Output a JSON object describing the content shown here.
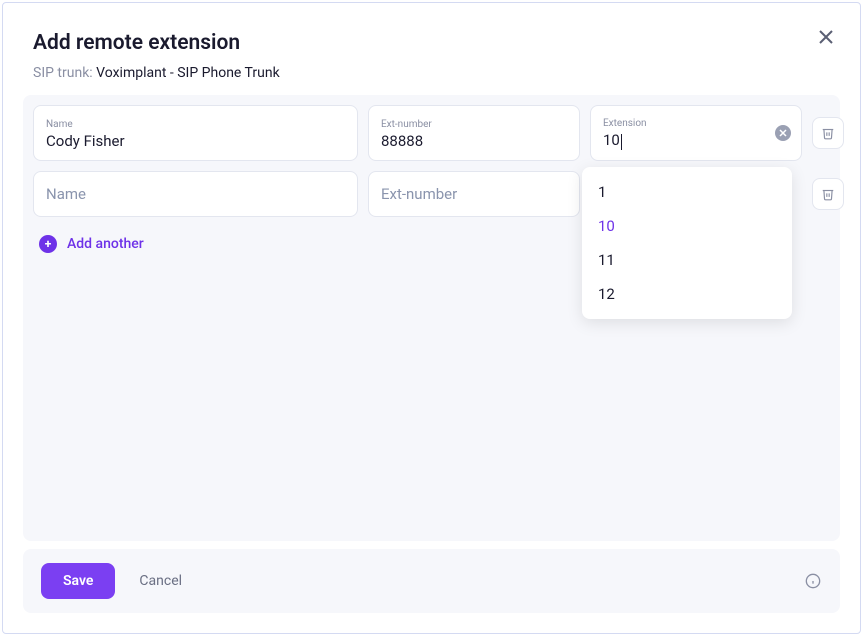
{
  "header": {
    "title": "Add remote extension",
    "subtitle_label": "SIP trunk:",
    "subtitle_value": "Voximplant -  SIP Phone Trunk"
  },
  "rows": [
    {
      "name_label": "Name",
      "name_value": "Cody Fisher",
      "ext_label": "Ext-number",
      "ext_value": "88888",
      "extension_label": "Extension",
      "extension_value": "10"
    },
    {
      "name_placeholder": "Name",
      "ext_placeholder": "Ext-number"
    }
  ],
  "dropdown": {
    "options": [
      "1",
      "10",
      "11",
      "12"
    ],
    "selected": "10"
  },
  "actions": {
    "add_another": "Add another",
    "save": "Save",
    "cancel": "Cancel"
  }
}
